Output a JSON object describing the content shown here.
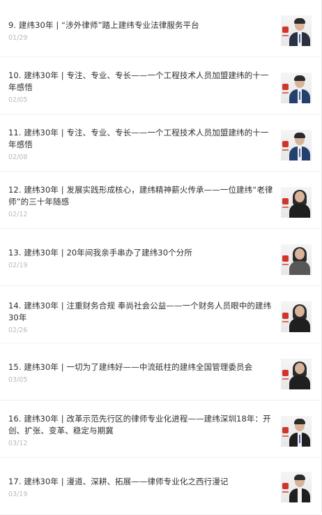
{
  "items": [
    {
      "title": "9. 建纬30年 | “涉外律师”踏上建纬专业法律服务平台",
      "date": "01/29"
    },
    {
      "title": "10. 建纬30年 | 专注、专业、专长——一个工程技术人员加盟建纬的十一年感悟",
      "date": "02/05"
    },
    {
      "title": "11. 建纬30年 | 专注、专业、专长——一个工程技术人员加盟建纬的十一年感悟",
      "date": "02/08"
    },
    {
      "title": "12. 建纬30年 | 发展实践形成核心，建纬精神薪火传承——一位建纬“老律师”的三十年随感",
      "date": "02/12"
    },
    {
      "title": "13. 建纬30年 | 20年间我亲手串办了建纬30个分所",
      "date": "02/19"
    },
    {
      "title": "14. 建纬30年 | 注重财务合规 奉尚社会公益——一个财务人员眼中的建纬30年",
      "date": "02/26"
    },
    {
      "title": "15. 建纬30年 | 一切为了建纬好——中流砥柱的建纬全国管理委员会",
      "date": "03/05"
    },
    {
      "title": "16. 建纬30年 | 改革示范先行区的律师专业化进程——建纬深圳18年：开创、扩张、变革、稳定与期冀",
      "date": "03/12"
    },
    {
      "title": "17. 建纬30年 | 漫道、深耕、拓展——律师专业化之西行漫记",
      "date": "03/19"
    }
  ],
  "colors": {
    "title": "#2f2f2f",
    "date": "#b9b9b9",
    "divider": "#f0f0f0",
    "logo": "#d0352b"
  },
  "icons": {
    "thumb_logo": "firm-logo-icon",
    "thumb_person": "portrait-photo"
  }
}
